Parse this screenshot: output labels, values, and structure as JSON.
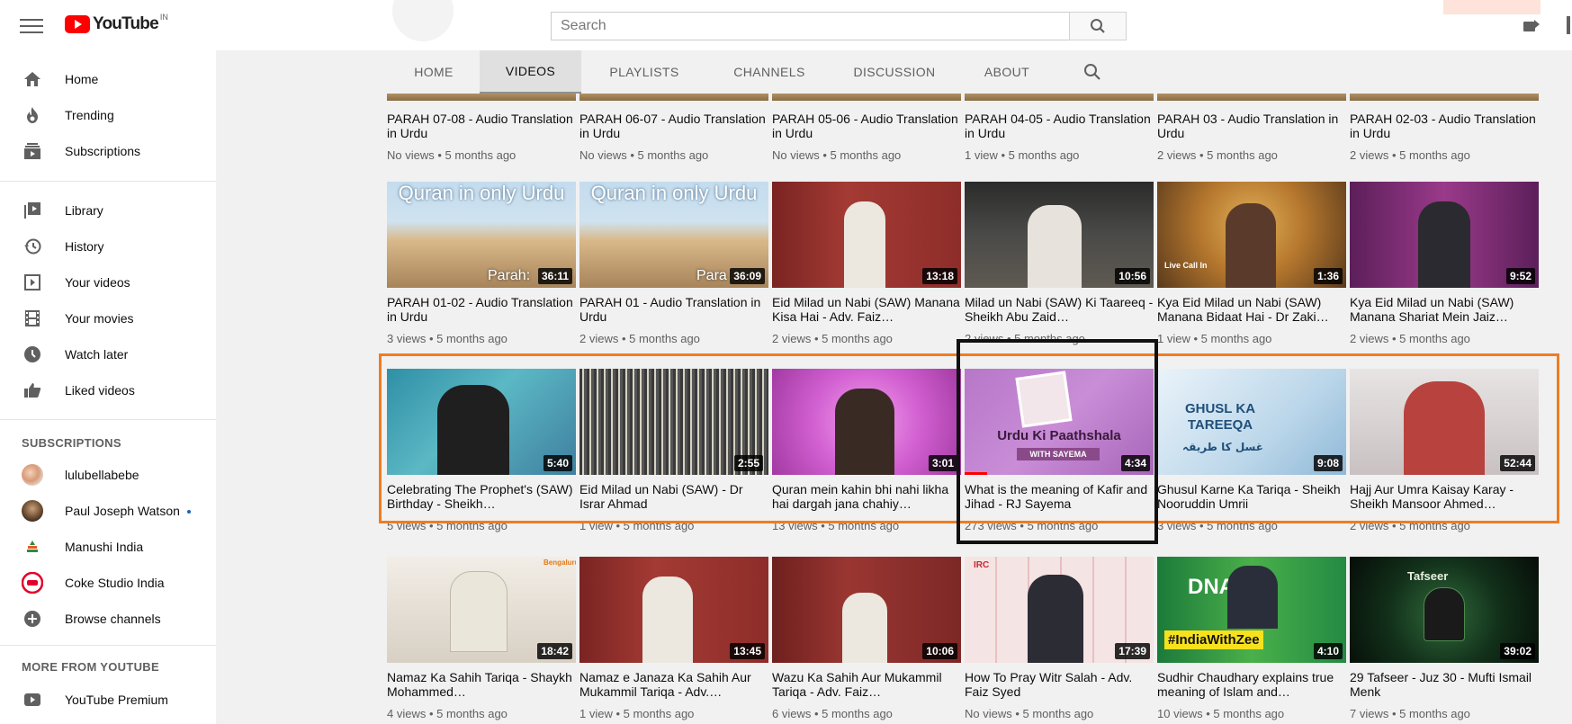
{
  "header": {
    "logo_text": "YouTube",
    "country_code": "IN",
    "search_placeholder": "Search"
  },
  "sidebar": {
    "main": [
      {
        "label": "Home",
        "icon": "home-icon"
      },
      {
        "label": "Trending",
        "icon": "flame-icon"
      },
      {
        "label": "Subscriptions",
        "icon": "subscriptions-icon"
      }
    ],
    "library": [
      {
        "label": "Library",
        "icon": "library-icon"
      },
      {
        "label": "History",
        "icon": "history-icon"
      },
      {
        "label": "Your videos",
        "icon": "play-square-icon"
      },
      {
        "label": "Your movies",
        "icon": "film-icon"
      },
      {
        "label": "Watch later",
        "icon": "clock-icon"
      },
      {
        "label": "Liked videos",
        "icon": "thumbs-up-icon"
      }
    ],
    "subscriptions_heading": "SUBSCRIPTIONS",
    "subscriptions": [
      {
        "label": "lulubellabebe"
      },
      {
        "label": "Paul Joseph Watson"
      },
      {
        "label": "Manushi India"
      },
      {
        "label": "Coke Studio India"
      },
      {
        "label": "Browse channels"
      }
    ],
    "more_heading": "MORE FROM YOUTUBE",
    "more": [
      {
        "label": "YouTube Premium"
      }
    ]
  },
  "tabs": [
    "HOME",
    "VIDEOS",
    "PLAYLISTS",
    "CHANNELS",
    "DISCUSSION",
    "ABOUT"
  ],
  "active_tab": "VIDEOS",
  "rows": [
    [
      {
        "title": "PARAH 07-08 - Audio Translation in Urdu",
        "meta": "No views • 5 months ago"
      },
      {
        "title": "PARAH 06-07 - Audio Translation in Urdu",
        "meta": "No views • 5 months ago"
      },
      {
        "title": "PARAH 05-06 - Audio Translation in Urdu",
        "meta": "No views • 5 months ago"
      },
      {
        "title": "PARAH 04-05 - Audio Translation in Urdu",
        "meta": "1 view • 5 months ago"
      },
      {
        "title": "PARAH 03 - Audio Translation in Urdu",
        "meta": "2 views • 5 months ago"
      },
      {
        "title": "PARAH 02-03 - Audio Translation in Urdu",
        "meta": "2 views • 5 months ago"
      }
    ],
    [
      {
        "title": "PARAH 01-02 - Audio Translation in Urdu",
        "meta": "3 views • 5 months ago",
        "duration": "36:11",
        "thumb_text": "Quran in only Urdu",
        "thumb_sub": "Parah:"
      },
      {
        "title": "PARAH 01 - Audio Translation in Urdu",
        "meta": "2 views • 5 months ago",
        "duration": "36:09",
        "thumb_text": "Quran in only Urdu",
        "thumb_sub": "Para"
      },
      {
        "title": "Eid Milad un Nabi (SAW) Manana Kisa Hai - Adv. Faiz…",
        "meta": "2 views • 5 months ago",
        "duration": "13:18"
      },
      {
        "title": "Milad un Nabi (SAW) Ki Taareeq - Sheikh Abu Zaid…",
        "meta": "2 views • 5 months ago",
        "duration": "10:56"
      },
      {
        "title": "Kya Eid Milad un Nabi (SAW) Manana Bidaat Hai - Dr Zaki…",
        "meta": "1 view • 5 months ago",
        "duration": "1:36",
        "thumb_text": "Live Call In"
      },
      {
        "title": "Kya Eid Milad un Nabi (SAW) Manana Shariat Mein Jaiz…",
        "meta": "2 views • 5 months ago",
        "duration": "9:52"
      }
    ],
    [
      {
        "title": "Celebrating The Prophet's (SAW) Birthday - Sheikh…",
        "meta": "5 views • 5 months ago",
        "duration": "5:40"
      },
      {
        "title": "Eid Milad un Nabi (SAW) - Dr Israr Ahmad",
        "meta": "1 view • 5 months ago",
        "duration": "2:55"
      },
      {
        "title": "Quran mein kahin bhi nahi likha hai dargah jana chahiy…",
        "meta": "13 views • 5 months ago",
        "duration": "3:01"
      },
      {
        "title": "What is the meaning of Kafir and Jihad - RJ Sayema",
        "meta": "273 views • 5 months ago",
        "duration": "4:34",
        "thumb_text": "Urdu Ki Paathshala",
        "thumb_sub": "WITH SAYEMA",
        "watched": 0.12
      },
      {
        "title": "Ghusul Karne Ka Tariqa - Sheikh Nooruddin Umrii",
        "meta": "3 views • 5 months ago",
        "duration": "9:08",
        "thumb_text": "GHUSL KA TAREEQA",
        "thumb_sub": "غسل کا طریقہ"
      },
      {
        "title": "Hajj Aur Umra Kaisay Karay - Sheikh Mansoor Ahmed…",
        "meta": "2 views • 5 months ago",
        "duration": "52:44"
      }
    ],
    [
      {
        "title": "Namaz Ka Sahih Tariqa - Shaykh Mohammed…",
        "meta": "4 views • 5 months ago",
        "duration": "18:42",
        "thumb_text": "Bengaluru"
      },
      {
        "title": "Namaz e Janaza Ka Sahih Aur Mukammil Tariqa - Adv.…",
        "meta": "1 view • 5 months ago",
        "duration": "13:45"
      },
      {
        "title": "Wazu Ka Sahih Aur Mukammil Tariqa - Adv. Faiz…",
        "meta": "6 views • 5 months ago",
        "duration": "10:06"
      },
      {
        "title": "How To Pray Witr Salah - Adv. Faiz Syed",
        "meta": "No views • 5 months ago",
        "duration": "17:39",
        "thumb_text": "IRC"
      },
      {
        "title": "Sudhir Chaudhary explains true meaning of Islam and…",
        "meta": "10 views • 5 months ago",
        "duration": "4:10",
        "thumb_text": "#IndiaWithZee",
        "thumb_sub": "DNA"
      },
      {
        "title": "29 Tafseer - Juz 30 - Mufti Ismail Menk",
        "meta": "7 views • 5 months ago",
        "duration": "39:02",
        "thumb_text": "Tafseer"
      }
    ]
  ],
  "colors": {
    "youtube_red": "#ff0000",
    "highlight_orange": "#f07c20",
    "highlight_black": "#111111"
  }
}
